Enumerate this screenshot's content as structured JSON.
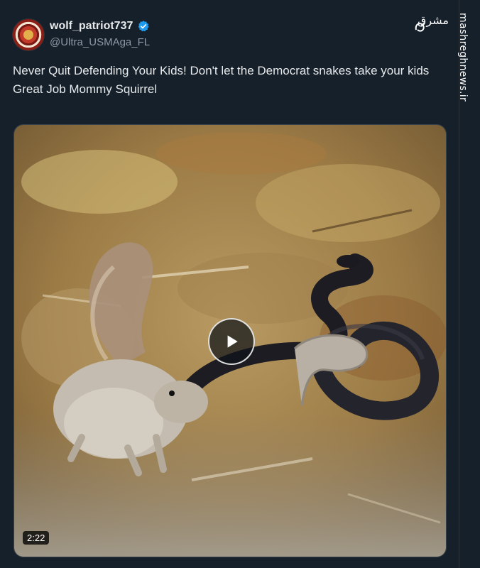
{
  "author": {
    "display_name": "wolf_patriot737",
    "handle": "@Ultra_USMAga_FL",
    "verified": true,
    "verified_color": "#1d9bf0"
  },
  "tweet": {
    "text": "Never Quit Defending Your Kids! Don't let the Democrat snakes take your kids\nGreat Job Mommy Squirrel"
  },
  "media": {
    "type": "video",
    "duration": "2:22",
    "play_icon": "play-icon"
  },
  "watermark": {
    "logo_text": "مشرق",
    "site": "mashreghnews.ir"
  },
  "colors": {
    "background": "#15202b",
    "text": "#e7e9ea",
    "secondary": "#8b98a5"
  }
}
